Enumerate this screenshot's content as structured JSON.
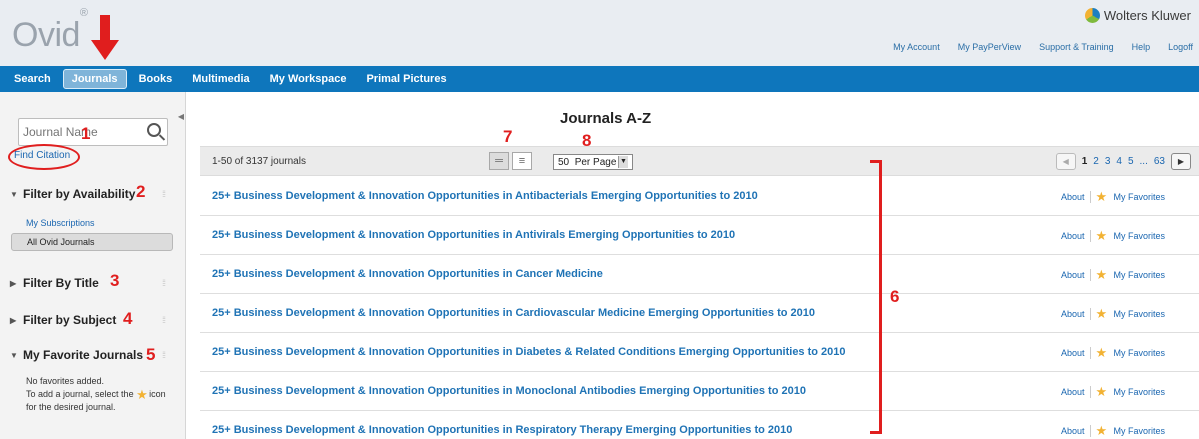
{
  "header": {
    "logo_text": "Ovid",
    "logo_mark": "®",
    "brand": "Wolters Kluwer",
    "links": [
      "My Account",
      "My PayPerView",
      "Support & Training",
      "Help",
      "Logoff"
    ]
  },
  "nav": {
    "tabs": [
      "Search",
      "Journals",
      "Books",
      "Multimedia",
      "My Workspace",
      "Primal Pictures"
    ],
    "active": "Journals"
  },
  "sidebar": {
    "search_placeholder": "Journal Name",
    "find_citation": "Find Citation",
    "filter_availability": "Filter by Availability",
    "my_subscriptions": "My Subscriptions",
    "all_ovid_journals": "All Ovid Journals",
    "filter_title": "Filter By Title",
    "filter_subject": "Filter by Subject",
    "my_favorites": "My Favorite Journals",
    "fav_line1": "No favorites added.",
    "fav_line2a": "To add a journal, select the",
    "fav_line2b": "icon",
    "fav_line3": "for the desired journal."
  },
  "main": {
    "title": "Journals A-Z",
    "result_count": "1-50 of 3137 journals",
    "per_page_value": "50",
    "per_page_label": "Per Page",
    "pages": [
      "1",
      "2",
      "3",
      "4",
      "5",
      "...",
      "63"
    ],
    "current_page": "1",
    "about_label": "About",
    "favorites_label": "My Favorites",
    "journals": [
      "25+ Business Development & Innovation Opportunities in Antibacterials Emerging Opportunities to 2010",
      "25+ Business Development & Innovation Opportunities in Antivirals Emerging Opportunities to 2010",
      "25+ Business Development & Innovation Opportunities in Cancer Medicine",
      "25+ Business Development & Innovation Opportunities in Cardiovascular Medicine Emerging Opportunities to 2010",
      "25+ Business Development & Innovation Opportunities in Diabetes & Related Conditions Emerging Opportunities to 2010",
      "25+ Business Development & Innovation Opportunities in Monoclonal Antibodies Emerging Opportunities to 2010",
      "25+ Business Development & Innovation Opportunities in Respiratory Therapy Emerging Opportunities to 2010"
    ]
  },
  "annotations": {
    "n1": "1",
    "n2": "2",
    "n3": "3",
    "n4": "4",
    "n5": "5",
    "n6": "6",
    "n7": "7",
    "n8": "8"
  },
  "colors": {
    "nav_blue": "#0e76bc",
    "link_blue": "#1f73b5",
    "annotation_red": "#e01e1e"
  }
}
